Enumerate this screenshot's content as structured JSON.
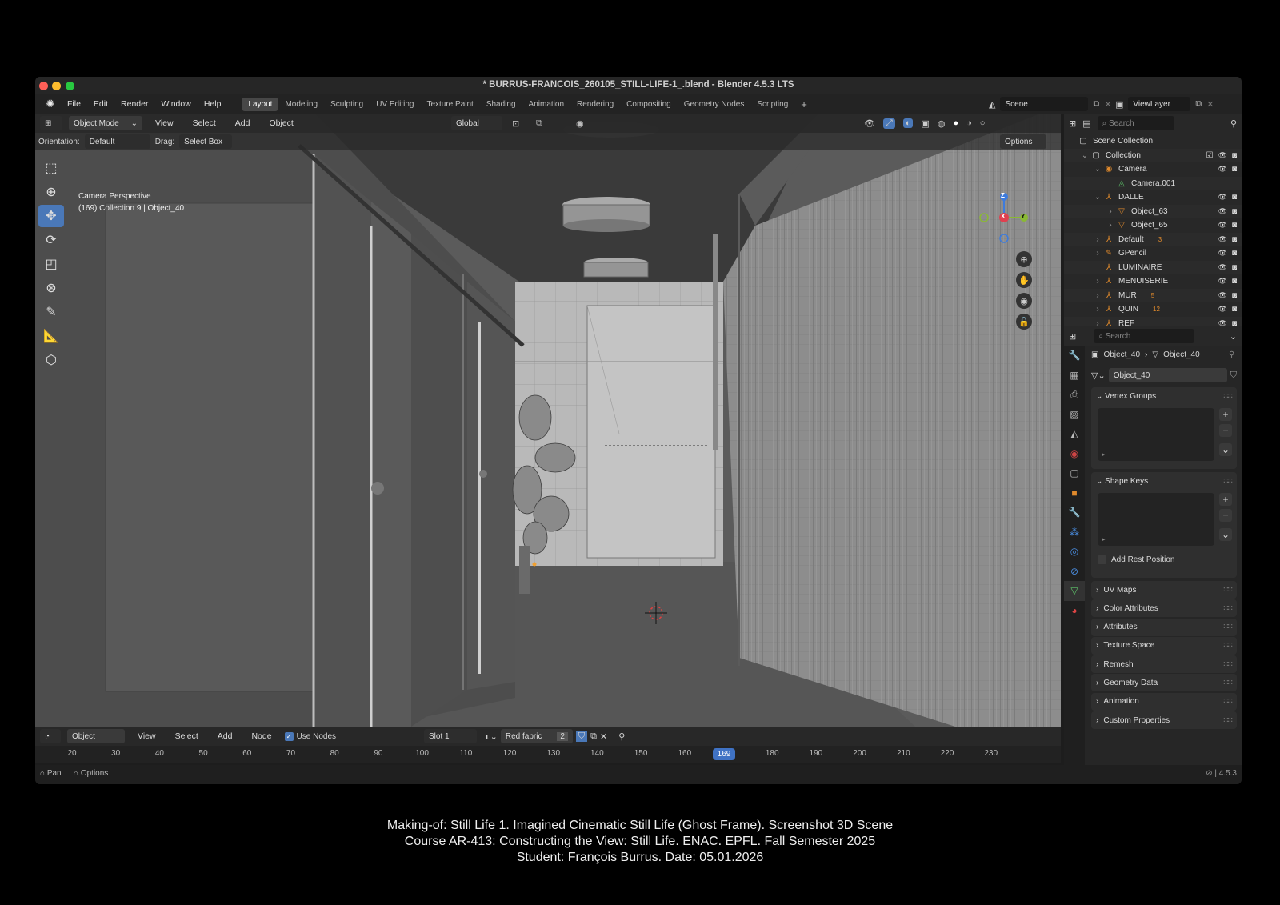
{
  "window": {
    "title": "* BURRUS-FRANCOIS_260105_STILL-LIFE-1_.blend - Blender 4.5.3 LTS"
  },
  "menu": [
    "File",
    "Edit",
    "Render",
    "Window",
    "Help"
  ],
  "workspaces": [
    {
      "label": "Layout",
      "active": true
    },
    {
      "label": "Modeling"
    },
    {
      "label": "Sculpting"
    },
    {
      "label": "UV Editing"
    },
    {
      "label": "Texture Paint"
    },
    {
      "label": "Shading"
    },
    {
      "label": "Animation"
    },
    {
      "label": "Rendering"
    },
    {
      "label": "Compositing"
    },
    {
      "label": "Geometry Nodes"
    },
    {
      "label": "Scripting"
    }
  ],
  "scene": {
    "name": "Scene",
    "view_layer": "ViewLayer"
  },
  "viewport_header": {
    "mode": "Object Mode",
    "menus": [
      "View",
      "Select",
      "Add",
      "Object"
    ],
    "transform": "Global",
    "options": "Options"
  },
  "tool_settings": {
    "orientation_label": "Orientation:",
    "orientation": "Default",
    "drag_label": "Drag:",
    "drag": "Select Box"
  },
  "viewport_overlay": {
    "line1": "Camera Perspective",
    "line2": "(169) Collection 9 | Object_40"
  },
  "gizmo": {
    "x": "X",
    "y": "Y",
    "z": "Z"
  },
  "outliner": {
    "search_placeholder": "Search",
    "items": [
      {
        "label": "Scene Collection",
        "indent": 0,
        "icon": "collection-icon"
      },
      {
        "label": "Collection",
        "indent": 1,
        "icon": "collection-icon"
      },
      {
        "label": "Camera",
        "indent": 2,
        "icon": "camera-icon"
      },
      {
        "label": "Camera.001",
        "indent": 3,
        "icon": "camera-data-icon"
      },
      {
        "label": "DALLE",
        "indent": 2,
        "icon": "empty-icon"
      },
      {
        "label": "Object_63",
        "indent": 3,
        "icon": "mesh-icon"
      },
      {
        "label": "Object_65",
        "indent": 3,
        "icon": "mesh-icon"
      },
      {
        "label": "Default",
        "indent": 2,
        "icon": "empty-icon"
      },
      {
        "label": "GPencil",
        "indent": 2,
        "icon": "gpencil-icon"
      },
      {
        "label": "LUMINAIRE",
        "indent": 2,
        "icon": "empty-icon"
      },
      {
        "label": "MENUISERIE",
        "indent": 2,
        "icon": "empty-icon"
      },
      {
        "label": "MUR",
        "indent": 2,
        "icon": "empty-icon"
      },
      {
        "label": "QUIN",
        "indent": 2,
        "icon": "empty-icon"
      },
      {
        "label": "REF",
        "indent": 2,
        "icon": "empty-icon"
      }
    ],
    "badges": {
      "Default": "3",
      "MUR": "5",
      "QUIN": "12"
    }
  },
  "properties": {
    "search_placeholder": "Search",
    "breadcrumb": [
      "Object_40",
      "Object_40"
    ],
    "mesh_name": "Object_40",
    "panels": {
      "vertex_groups": "Vertex Groups",
      "shape_keys": "Shape Keys",
      "add_rest_position": "Add Rest Position"
    },
    "collapsed": [
      "UV Maps",
      "Color Attributes",
      "Attributes",
      "Texture Space",
      "Remesh",
      "Geometry Data",
      "Animation",
      "Custom Properties"
    ]
  },
  "shader_header": {
    "type": "Object",
    "menus": [
      "View",
      "Select",
      "Add",
      "Node"
    ],
    "use_nodes": "Use Nodes",
    "slot": "Slot 1",
    "material": "Red fabric",
    "users": "2"
  },
  "timeline": {
    "ticks": [
      20,
      30,
      40,
      50,
      60,
      70,
      80,
      90,
      100,
      110,
      120,
      130,
      140,
      150,
      160,
      170,
      180,
      190,
      200,
      210,
      220,
      230
    ],
    "current": "169"
  },
  "status": {
    "pan": "Pan",
    "options": "Options",
    "version": "4.5.3"
  },
  "caption": [
    "Making-of: Still Life 1. Imagined Cinematic Still Life (Ghost Frame). Screenshot 3D Scene",
    "Course AR-413: Constructing the View: Still Life. ENAC. EPFL. Fall Semester 2025",
    "Student: François Burrus. Date: 05.01.2026"
  ],
  "colors": {
    "accent": "#4a78b8",
    "timeline_current": "#3f72c4",
    "gizmo_x": "#e0404f",
    "gizmo_y": "#8ab934",
    "gizmo_z": "#3d7bdc"
  }
}
